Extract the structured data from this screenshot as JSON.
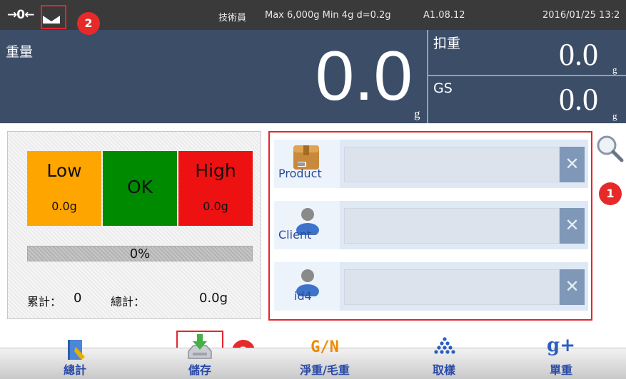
{
  "status_bar": {
    "zero_indicator": "→0←",
    "user_role": "技術員",
    "spec": "Max 6,000g  Min 4g  d=0.2g",
    "version": "A1.08.12",
    "datetime": "2016/01/25  13:2"
  },
  "weight": {
    "main_label": "重量",
    "main_value": "0.0",
    "main_unit": "g",
    "tare_label": "扣重",
    "tare_value": "0.0",
    "tare_unit": "g",
    "gs_label": "GS",
    "gs_value": "0.0",
    "gs_unit": "g"
  },
  "check": {
    "low_label": "Low",
    "low_value": "0.0g",
    "ok_label": "OK",
    "high_label": "High",
    "high_value": "0.0g",
    "progress_text": "0%",
    "progress_fraction": 0,
    "count_label": "累計：",
    "count_value": "0",
    "total_label": "總計：",
    "total_value": "0.0g"
  },
  "id_fields": [
    {
      "label": "Product",
      "value": "",
      "icon": "product-box-icon"
    },
    {
      "label": "Client",
      "value": "",
      "icon": "person-icon"
    },
    {
      "label": "id4",
      "value": "",
      "icon": "person-icon"
    }
  ],
  "clear_glyph": "✕",
  "callouts": [
    "1",
    "2",
    "3"
  ],
  "toolbar": {
    "total_label": "總計",
    "save_label": "儲存",
    "gn_icon_text": "G/N",
    "netgross_label": "淨重/毛重",
    "sample_label": "取樣",
    "unit_icon_text": "g+",
    "unitweight_label": "單重"
  },
  "colors": {
    "low": "#ffa500",
    "ok": "#008a00",
    "high": "#ee1111",
    "panel": "#3c4d68",
    "highlight": "#e5252b"
  }
}
